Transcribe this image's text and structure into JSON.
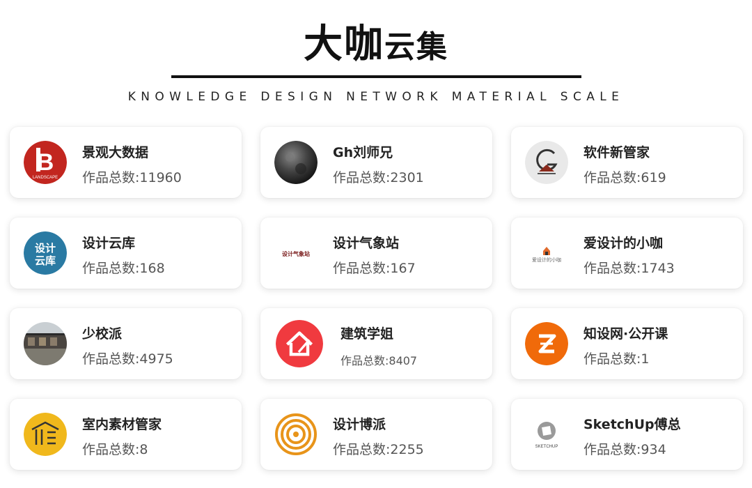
{
  "header": {
    "title_big": "大咖",
    "title_small": "云集",
    "subtitle": "KNOWLEDGE DESIGN NETWORK MATERIAL SCALE"
  },
  "cards": [
    {
      "name": "景观大数据",
      "count": "作品总数:11960",
      "logo_icon": "landscape-b-logo-icon",
      "color": "#c2261f"
    },
    {
      "name": "Gh刘师兄",
      "count": "作品总数:2301",
      "logo_icon": "dark-texture-logo-icon",
      "color": "#333333"
    },
    {
      "name": "软件新管家",
      "count": "作品总数:619",
      "logo_icon": "g-house-logo-icon",
      "color": "#8a2a1c"
    },
    {
      "name": "设计云库",
      "count": "作品总数:168",
      "logo_icon": "design-cloud-logo-icon",
      "color": "#2a7aa3"
    },
    {
      "name": "设计气象站",
      "count": "作品总数:167",
      "logo_icon": "text-logo-icon",
      "color": "#7a1c1c"
    },
    {
      "name": "爱设计的小咖",
      "count": "作品总数:1743",
      "logo_icon": "small-house-logo-icon",
      "color": "#e06a2c"
    },
    {
      "name": "少校派",
      "count": "作品总数:4975",
      "logo_icon": "building-photo-logo-icon",
      "color": "#6a6a6a"
    },
    {
      "name": "建筑学姐",
      "count": "作品总数:8407",
      "logo_icon": "red-house-logo-icon",
      "color": "#f03a3f"
    },
    {
      "name": "知设网·公开课",
      "count": "作品总数:1",
      "logo_icon": "z-logo-icon",
      "color": "#f06a0a"
    },
    {
      "name": "室内素材管家",
      "count": "作品总数:8",
      "logo_icon": "roof-logo-icon",
      "color": "#f0b81c"
    },
    {
      "name": "设计博派",
      "count": "作品总数:2255",
      "logo_icon": "rings-logo-icon",
      "color": "#e8941a"
    },
    {
      "name": "SketchUp傅总",
      "count": "作品总数:934",
      "logo_icon": "sketchup-logo-icon",
      "color": "#9a9a9a"
    }
  ]
}
